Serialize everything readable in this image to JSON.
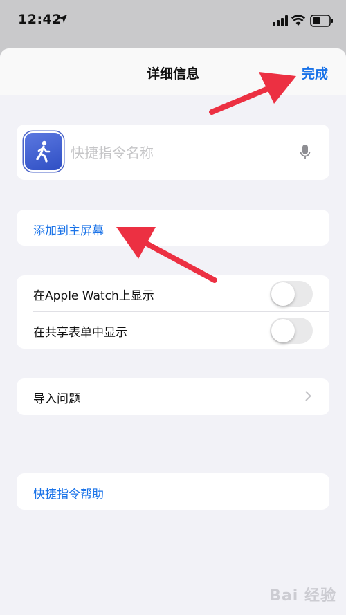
{
  "status_bar": {
    "time": "12:42",
    "icons": [
      "location-arrow-icon",
      "signal-icon",
      "wifi-icon",
      "battery-icon"
    ]
  },
  "nav": {
    "title": "详细信息",
    "done_label": "完成"
  },
  "shortcut": {
    "placeholder": "快捷指令名称",
    "icon": "walking-person-icon",
    "icon_color": "#3f5fd0"
  },
  "add_to_home": {
    "label": "添加到主屏幕"
  },
  "toggles": [
    {
      "label": "在Apple Watch上显示",
      "on": false
    },
    {
      "label": "在共享表单中显示",
      "on": false
    }
  ],
  "import_questions": {
    "label": "导入问题"
  },
  "help": {
    "label": "快捷指令帮助"
  },
  "watermark": {
    "text": "Bai 经验"
  },
  "colors": {
    "accent": "#1a73e8",
    "arrow": "#ec3042",
    "sheet_bg": "#f2f2f7"
  }
}
